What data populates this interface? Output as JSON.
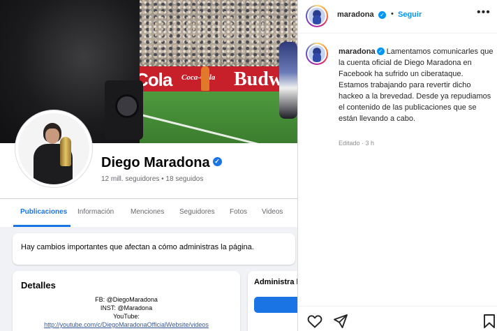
{
  "facebook": {
    "page_name": "Diego Maradona",
    "stats": "12 mill. seguidores • 18 seguidos",
    "cover_ads": {
      "cola": "Cola",
      "cocacola": "Coca-Cola",
      "bud": "Budw"
    },
    "tabs": [
      {
        "label": "Publicaciones",
        "active": true
      },
      {
        "label": "Información"
      },
      {
        "label": "Menciones"
      },
      {
        "label": "Seguidores"
      },
      {
        "label": "Fotos"
      },
      {
        "label": "Videos"
      }
    ],
    "notice": "Hay cambios importantes que afectan a cómo administras la página.",
    "details": {
      "title": "Detalles",
      "fb": "FB: @DiegoMaradona",
      "inst": "INST: @Maradona",
      "youtube_label": "YouTube:",
      "youtube_url": "http://youtube.com/c/DiegoMaradonaOfficialWebsite/videos"
    },
    "side_title": "Administra l",
    "colors": {
      "accent": "#1b74e4",
      "background": "#f0f2f5"
    }
  },
  "instagram": {
    "username": "maradona",
    "follow_label": "Seguir",
    "separator": "•",
    "more_icon": "more-horizontal-icon",
    "caption_text": "Lamentamos comunicarles que la cuenta oficial de Diego Maradona en Facebook ha sufrido un ciberataque. Estamos trabajando para revertir dicho hackeo a la brevedad. Desde ya repudiamos el contenido de las publicaciones que se están llevando a cabo.",
    "meta": "Editado · 3 h",
    "actions": [
      "heart-icon",
      "share-icon",
      "bookmark-icon"
    ],
    "colors": {
      "link": "#0095f6",
      "text": "#262626",
      "muted": "#8e8e8e"
    }
  }
}
